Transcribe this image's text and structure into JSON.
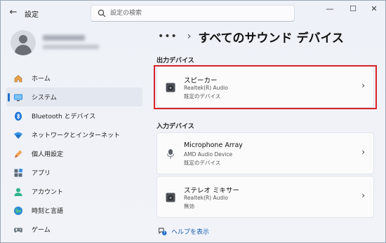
{
  "window": {
    "app_title": "設定"
  },
  "search": {
    "placeholder": "設定の検索"
  },
  "window_controls": {
    "minimize": "—",
    "maximize": "☐",
    "close": "✕"
  },
  "sidebar": {
    "items": [
      {
        "label": "ホーム",
        "icon": "home-icon"
      },
      {
        "label": "システム",
        "icon": "system-icon",
        "active": true
      },
      {
        "label": "Bluetooth とデバイス",
        "icon": "bluetooth-icon"
      },
      {
        "label": "ネットワークとインターネット",
        "icon": "network-icon"
      },
      {
        "label": "個人用設定",
        "icon": "personalization-icon"
      },
      {
        "label": "アプリ",
        "icon": "apps-icon"
      },
      {
        "label": "アカウント",
        "icon": "account-icon"
      },
      {
        "label": "時刻と言語",
        "icon": "time-language-icon"
      },
      {
        "label": "ゲーム",
        "icon": "gaming-icon"
      }
    ]
  },
  "breadcrumb": {
    "more": "•••",
    "separator": "›",
    "title": "すべてのサウンド デバイス"
  },
  "output_section": {
    "label": "出力デバイス",
    "devices": [
      {
        "name": "スピーカー",
        "driver": "Realtek(R) Audio",
        "status": "既定のデバイス",
        "icon": "speaker-icon"
      }
    ]
  },
  "input_section": {
    "label": "入力デバイス",
    "devices": [
      {
        "name": "Microphone Array",
        "driver": "AMD Audio Device",
        "status": "既定のデバイス",
        "icon": "microphone-icon"
      },
      {
        "name": "ステレオ ミキサー",
        "driver": "Realtek(R) Audio",
        "status": "無効",
        "icon": "speaker-icon"
      }
    ]
  },
  "help": {
    "label": "ヘルプを表示",
    "icon": "help-icon"
  },
  "colors": {
    "accent": "#1f6fc8",
    "highlight": "#d8232a",
    "link": "#1a5fb4"
  }
}
